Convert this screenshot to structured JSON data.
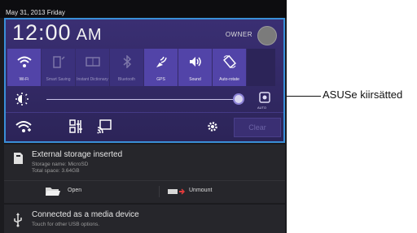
{
  "status_bar": {
    "date": "May 31, 2013 Friday"
  },
  "header": {
    "time": "12:00",
    "ampm": "AM",
    "user": "OWNER"
  },
  "quick_settings": [
    {
      "label": "Wi-Fi",
      "on": true,
      "icon": "wifi-icon"
    },
    {
      "label": "Smart Saving",
      "on": false,
      "icon": "battery-icon"
    },
    {
      "label": "Instant Dictionary",
      "on": false,
      "icon": "dictionary-icon"
    },
    {
      "label": "Bluetooth",
      "on": false,
      "icon": "bluetooth-icon"
    },
    {
      "label": "GPS",
      "on": true,
      "icon": "gps-icon"
    },
    {
      "label": "Sound",
      "on": true,
      "icon": "sound-icon"
    },
    {
      "label": "Auto-rotate",
      "on": true,
      "icon": "rotate-icon"
    }
  ],
  "brightness": {
    "auto_label": "AUTO",
    "level": 0.96
  },
  "toolbar": {
    "clear_label": "Clear"
  },
  "notifications": [
    {
      "title": "External storage inserted",
      "line1": "Storage name: MicroSD",
      "line2": "Total space: 3.64GB",
      "actions": [
        {
          "label": "Open"
        },
        {
          "label": "Unmount"
        }
      ]
    },
    {
      "title": "Connected as a media device",
      "line1": "Touch for other USB options."
    }
  ],
  "callout": {
    "text": "ASUSe kiirsätted"
  }
}
